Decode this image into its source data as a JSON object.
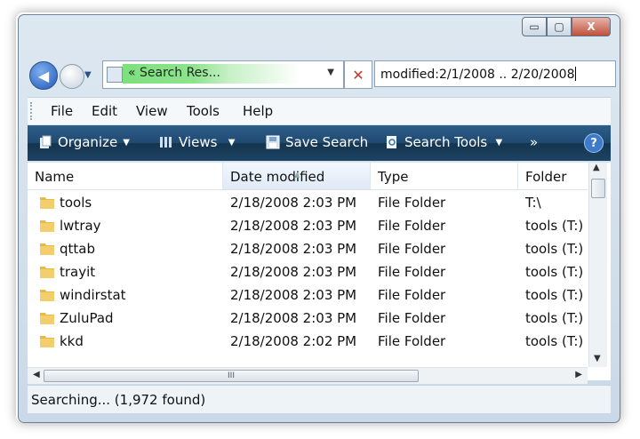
{
  "window": {
    "caption": {
      "minimize": "▭",
      "maximize": "▢",
      "close": "X"
    }
  },
  "nav": {
    "address_crumb": "« Search Res...",
    "stop_symbol": "✕",
    "search_query": "modified:2/1/2008 .. 2/20/2008"
  },
  "menu": [
    "File",
    "Edit",
    "View",
    "Tools",
    "Help"
  ],
  "toolbar": {
    "organize": "Organize",
    "views": "Views",
    "save_search": "Save Search",
    "search_tools": "Search Tools",
    "more": "»",
    "help": "?"
  },
  "columns": [
    "Name",
    "Date modified",
    "Type",
    "Folder"
  ],
  "rows": [
    {
      "name": "tools",
      "date": "2/18/2008 2:03 PM",
      "type": "File Folder",
      "folder": "T:\\"
    },
    {
      "name": "lwtray",
      "date": "2/18/2008 2:03 PM",
      "type": "File Folder",
      "folder": "tools (T:)"
    },
    {
      "name": "qttab",
      "date": "2/18/2008 2:03 PM",
      "type": "File Folder",
      "folder": "tools (T:)"
    },
    {
      "name": "trayit",
      "date": "2/18/2008 2:03 PM",
      "type": "File Folder",
      "folder": "tools (T:)"
    },
    {
      "name": "windirstat",
      "date": "2/18/2008 2:03 PM",
      "type": "File Folder",
      "folder": "tools (T:)"
    },
    {
      "name": "ZuluPad",
      "date": "2/18/2008 2:03 PM",
      "type": "File Folder",
      "folder": "tools (T:)"
    },
    {
      "name": "kkd",
      "date": "2/18/2008 2:02 PM",
      "type": "File Folder",
      "folder": "tools (T:)"
    }
  ],
  "status": "Searching... (1,972 found)",
  "colors": {
    "toolbar": "#1f4a70",
    "accent": "#2c4f86",
    "folder": "#e8b84a"
  }
}
